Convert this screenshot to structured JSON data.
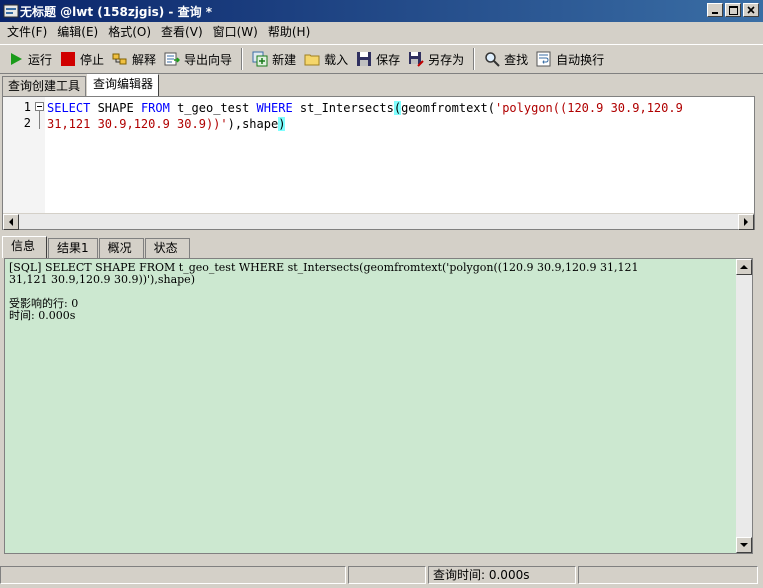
{
  "window": {
    "title": "无标题 @lwt (158zjgis) - 查询 *"
  },
  "menu": [
    "文件(F)",
    "编辑(E)",
    "格式(O)",
    "查看(V)",
    "窗口(W)",
    "帮助(H)"
  ],
  "toolbar": {
    "run": "运行",
    "stop": "停止",
    "explain": "解释",
    "export_wizard": "导出向导",
    "new": "新建",
    "load": "载入",
    "save": "保存",
    "save_as": "另存为",
    "find": "查找",
    "word_wrap": "自动换行"
  },
  "top_tabs": [
    "查询创建工具",
    "查询编辑器"
  ],
  "editor": {
    "line_numbers": [
      "1",
      "2"
    ],
    "line1": {
      "kw1": "SELECT",
      "t1": " SHAPE ",
      "kw2": "FROM",
      "t2": " t_geo_test ",
      "kw3": "WHERE",
      "t3": " st_Intersects",
      "p_open": "(",
      "t4": "geomfromtext(",
      "str1": "'polygon((120.9 30.9,120.9"
    },
    "line2": {
      "str2": "31,121 30.9,120.9 30.9))'",
      "t5": "),shape",
      "p_close": ")"
    }
  },
  "bottom_tabs": [
    "信息",
    "结果1",
    "概况",
    "状态"
  ],
  "info": {
    "line1": "[SQL] SELECT SHAPE FROM t_geo_test WHERE st_Intersects(geomfromtext('polygon((120.9 30.9,120.9 31,121",
    "line2": "31,121 30.9,120.9 30.9))'),shape)",
    "line3": "",
    "line4": "受影响的行: 0",
    "line5": "时间: 0.000s"
  },
  "status": {
    "query_time": "查询时间: 0.000s"
  }
}
